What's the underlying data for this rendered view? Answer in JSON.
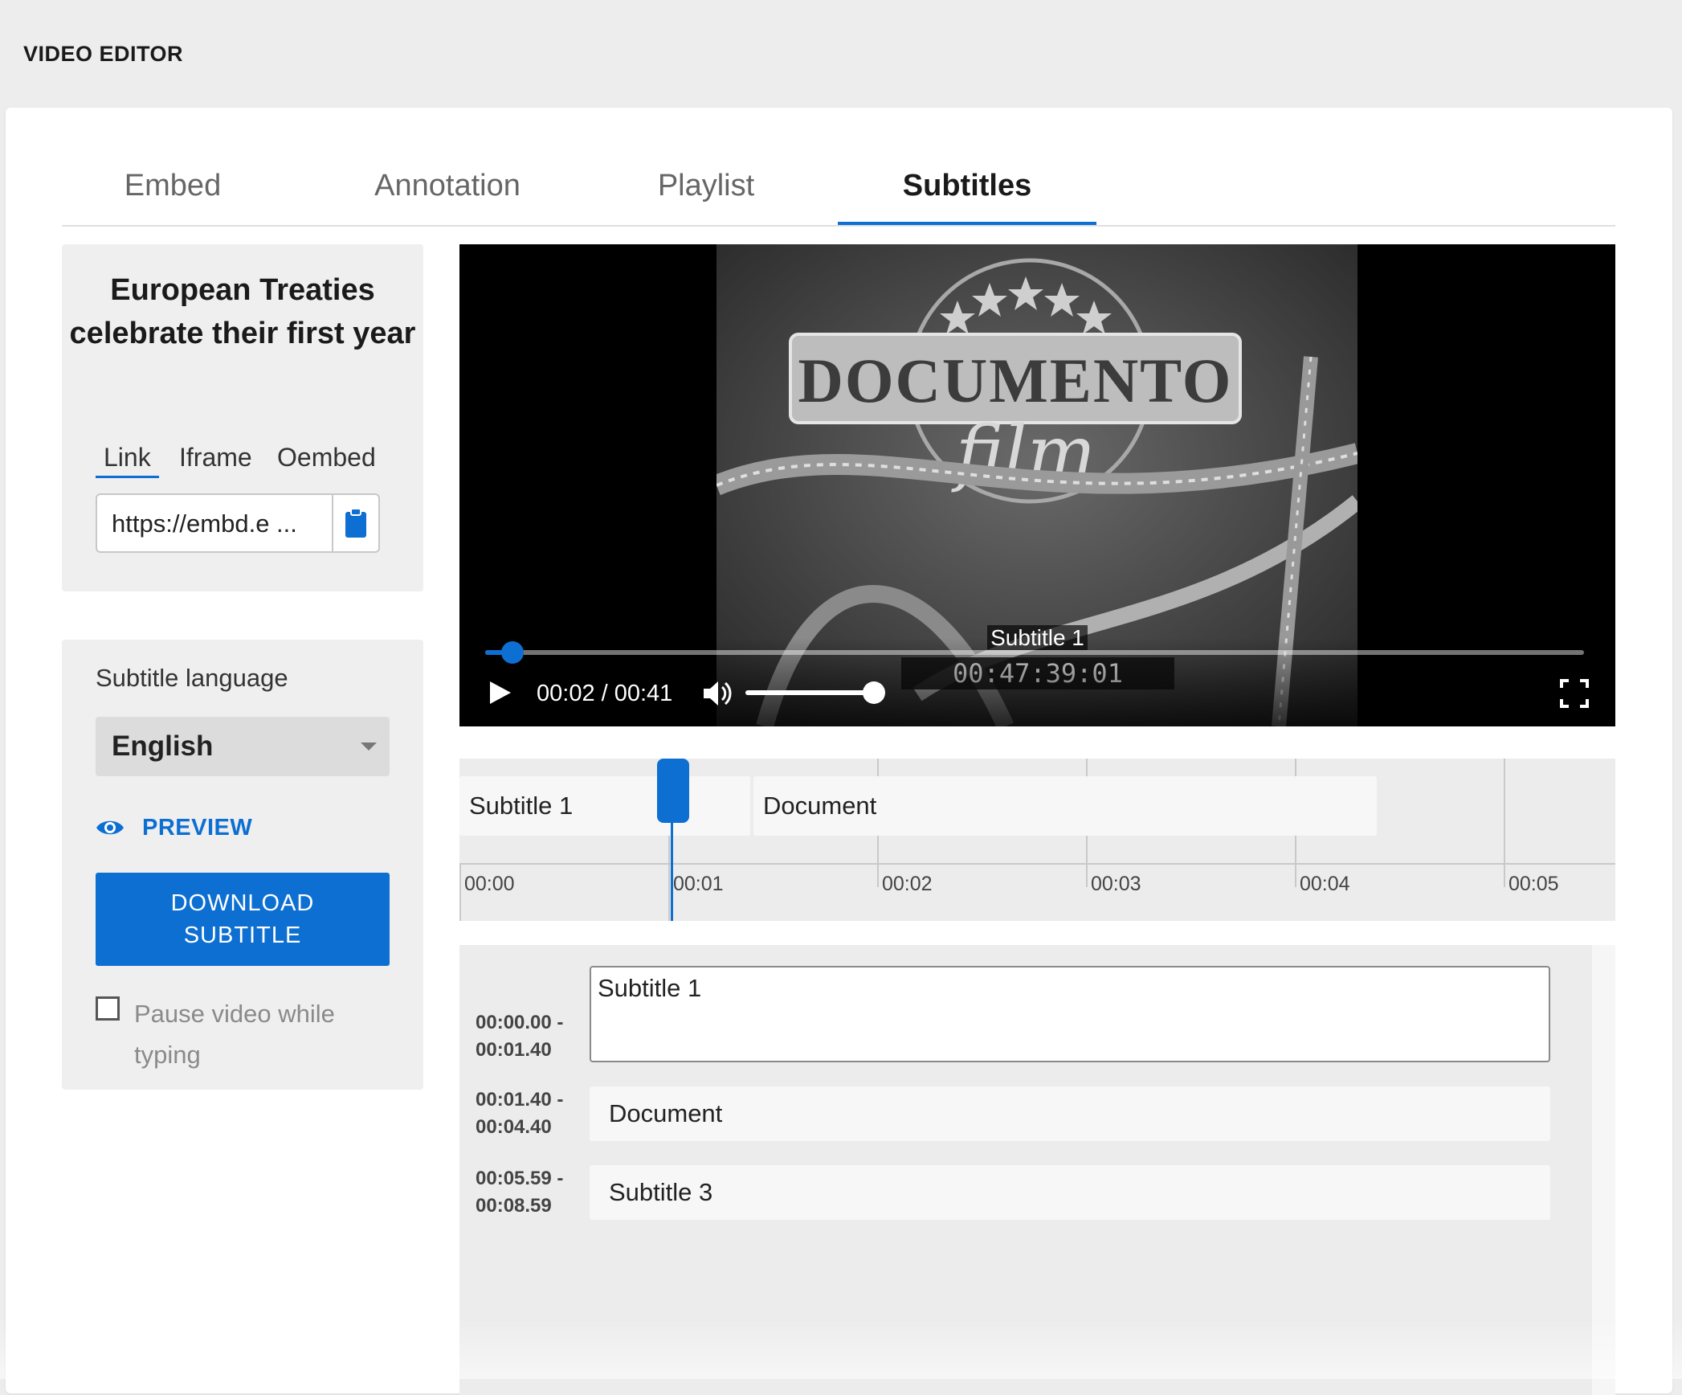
{
  "app": {
    "title": "VIDEO EDITOR"
  },
  "tabs": [
    {
      "label": "Embed",
      "active": false
    },
    {
      "label": "Annotation",
      "active": false
    },
    {
      "label": "Playlist",
      "active": false
    },
    {
      "label": "Subtitles",
      "active": true
    }
  ],
  "video_info": {
    "title": "European Treaties celebrate their first year",
    "embed_tabs": [
      "Link",
      "Iframe",
      "Oembed"
    ],
    "embed_active": "Link",
    "url_value": "https://embd.e ..."
  },
  "subtitle_settings": {
    "language_label": "Subtitle language",
    "language_value": "English",
    "preview_label": "PREVIEW",
    "download_label": "DOWNLOAD SUBTITLE",
    "pause_label": "Pause video while typing",
    "pause_checked": false
  },
  "player": {
    "current_subtitle": "Subtitle 1",
    "time_display": "00:02 / 00:41",
    "progress": 0.025,
    "volume": 1.0
  },
  "timeline": {
    "ticks": [
      "00:00",
      "00:01",
      "00:02",
      "00:03",
      "00:04",
      "00:05"
    ],
    "playhead_time": "00:01",
    "blocks": [
      {
        "label": "Subtitle 1",
        "start": 0.0,
        "end": 1.4
      },
      {
        "label": "Document",
        "start": 1.4,
        "end": 4.4
      }
    ]
  },
  "subtitles": [
    {
      "range": "00:00.00 -\n00:01.40",
      "start": "00:00.00 -",
      "end": "00:01.40",
      "text": "Subtitle 1",
      "editing": true
    },
    {
      "range": "00:01.40 -\n00:04.40",
      "start": "00:01.40 -",
      "end": "00:04.40",
      "text": "Document",
      "editing": false
    },
    {
      "range": "00:05.59 -\n00:08.59",
      "start": "00:05.59 -",
      "end": "00:08.59",
      "text": "Subtitle 3",
      "editing": false
    }
  ],
  "colors": {
    "accent": "#0d6fd1",
    "panel": "#efefef",
    "page_bg": "#ededed"
  },
  "icons": [
    "clipboard-icon",
    "eye-icon",
    "play-icon",
    "volume-icon",
    "fullscreen-icon",
    "chevron-down-icon"
  ]
}
